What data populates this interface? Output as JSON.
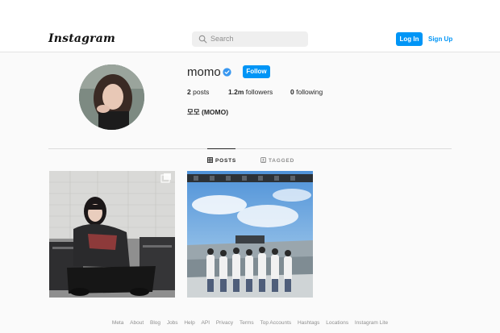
{
  "nav": {
    "logo": "Instagram",
    "search_placeholder": "Search",
    "login_label": "Log In",
    "signup_label": "Sign Up"
  },
  "profile": {
    "username": "momo",
    "verified": true,
    "follow_label": "Follow",
    "posts_count": "2",
    "posts_label": "posts",
    "followers_count": "1.2m",
    "followers_label": "followers",
    "following_count": "0",
    "following_label": "following",
    "full_name": "모모 (MOMO)"
  },
  "tabs": [
    {
      "label": "POSTS",
      "icon": "grid-icon",
      "active": true
    },
    {
      "label": "TAGGED",
      "icon": "tag-icon",
      "active": false
    }
  ],
  "posts": [
    {
      "description_icon": "multi-photo-icon"
    },
    {}
  ],
  "footer": {
    "links": [
      "Meta",
      "About",
      "Blog",
      "Jobs",
      "Help",
      "API",
      "Privacy",
      "Terms",
      "Top Accounts",
      "Hashtags",
      "Locations",
      "Instagram Lite"
    ]
  },
  "colors": {
    "accent": "#0095f6",
    "background": "#fafafa",
    "text": "#262626",
    "muted": "#8e8e8e"
  }
}
